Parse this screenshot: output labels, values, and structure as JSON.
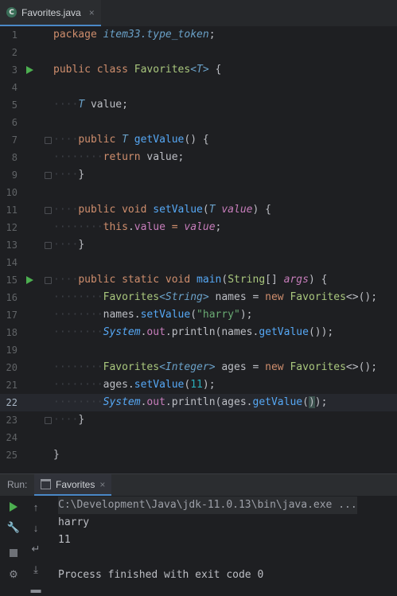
{
  "tab": {
    "icon": "C",
    "label": "Favorites.java",
    "close": "×"
  },
  "lines": [
    {
      "n": "1"
    },
    {
      "n": "2"
    },
    {
      "n": "3"
    },
    {
      "n": "4"
    },
    {
      "n": "5"
    },
    {
      "n": "6"
    },
    {
      "n": "7"
    },
    {
      "n": "8"
    },
    {
      "n": "9"
    },
    {
      "n": "10"
    },
    {
      "n": "11"
    },
    {
      "n": "12"
    },
    {
      "n": "13"
    },
    {
      "n": "14"
    },
    {
      "n": "15"
    },
    {
      "n": "16"
    },
    {
      "n": "17"
    },
    {
      "n": "18"
    },
    {
      "n": "19"
    },
    {
      "n": "20"
    },
    {
      "n": "21"
    },
    {
      "n": "22"
    },
    {
      "n": "23"
    },
    {
      "n": "24"
    },
    {
      "n": "25"
    }
  ],
  "code": {
    "l1": {
      "kw": "package",
      "pkg": "item33.type_token",
      "semi": ";"
    },
    "l3": {
      "kw1": "public",
      "kw2": "class",
      "cls": "Favorites",
      "tp": "<T>",
      "brace": "{"
    },
    "l5": {
      "tp": "T",
      "name": "value;"
    },
    "l7": {
      "kw": "public",
      "tp": "T",
      "fn": "getValue",
      "rest": "() {"
    },
    "l8": {
      "kw": "return",
      "rest": "value;"
    },
    "l9": {
      "rest": "}"
    },
    "l11": {
      "kw1": "public",
      "kw2": "void",
      "fn": "setValue",
      "open": "(",
      "tp": "T",
      "par": "value",
      "close": ") {"
    },
    "l12": {
      "kw": "this",
      "dot": ".",
      "fld": "value",
      "eq": " = ",
      "par": "value",
      "semi": ";"
    },
    "l13": {
      "rest": "}"
    },
    "l15": {
      "kw1": "public",
      "kw2": "static",
      "kw3": "void",
      "fn": "main",
      "open": "(",
      "cls": "String",
      "arr": "[] ",
      "par": "args",
      "close": ") {"
    },
    "l16": {
      "cls": "Favorites",
      "tp": "<String>",
      "var": " names = ",
      "kw": "new",
      "cls2": "Favorites",
      "rest": "<>();"
    },
    "l17": {
      "var": "names.",
      "fn": "setValue",
      "open": "(",
      "str": "\"harry\"",
      "close": ");"
    },
    "l18": {
      "stc": "System",
      "dot1": ".",
      "fld": "out",
      "dot2": ".",
      "call": "println",
      "rest": "(names.",
      "fn": "getValue",
      "end": "());"
    },
    "l20": {
      "cls": "Favorites",
      "tp": "<Integer>",
      "var": " ages = ",
      "kw": "new",
      "cls2": "Favorites",
      "rest": "<>();"
    },
    "l21": {
      "var": "ages.",
      "fn": "setValue",
      "open": "(",
      "num": "11",
      "close": ");"
    },
    "l22": {
      "stc": "System",
      "dot1": ".",
      "fld": "out",
      "dot2": ".",
      "call": "println",
      "rest": "(ages.",
      "fn": "getValue",
      "open": "(",
      "hl": ")",
      "end": ");"
    },
    "l23": {
      "rest": "}"
    },
    "l25": {
      "rest": "}"
    }
  },
  "indent": {
    "one": "····",
    "two": "········"
  },
  "run": {
    "label": "Run:",
    "tab_label": "Favorites",
    "close": "×",
    "output": [
      "C:\\Development\\Java\\jdk-11.0.13\\bin\\java.exe ...",
      "harry",
      "11",
      "",
      "Process finished with exit code 0"
    ]
  },
  "colors": {
    "accent": "#4a88c7",
    "run_green": "#4caf50",
    "keyword": "#cf8e6d",
    "string": "#6aab73",
    "number": "#2aacb8"
  }
}
